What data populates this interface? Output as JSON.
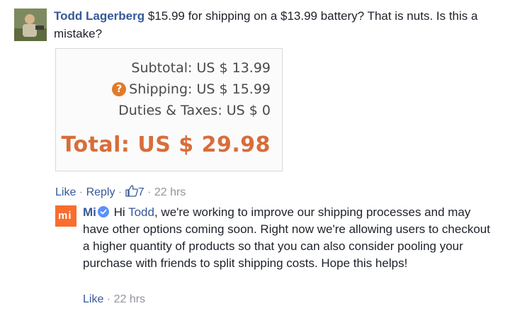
{
  "comment": {
    "author": "Todd Lagerberg",
    "text": " $15.99 for shipping on a $13.99 battery? That is nuts. Is this a mistake?",
    "attachment": {
      "subtotal": "Subtotal: US $ 13.99",
      "shipping": "Shipping: US $ 15.99",
      "shipping_icon": "?",
      "duties": "Duties & Taxes: US $ 0",
      "total": "Total: US $ 29.98"
    },
    "actions": {
      "like": "Like",
      "sep1": " · ",
      "reply": "Reply",
      "sep2": " · ",
      "like_count": "7",
      "sep3": " · ",
      "time": "22 hrs"
    }
  },
  "reply": {
    "logo_text": "mi",
    "author": "Mi",
    "text_before": " Hi ",
    "mention": "Todd",
    "text_after": ", we're working to improve our shipping processes and may have other options coming soon. Right now we're allowing users to checkout a higher quantity of products so that you can also consider pooling your purchase with friends to split shipping costs. Hope this helps!",
    "actions": {
      "like": "Like",
      "sep": " · ",
      "time": "22 hrs"
    }
  },
  "colors": {
    "link": "#365899",
    "meta": "#90949c",
    "total": "#d86d3a",
    "mi_brand": "#f96d2f",
    "verified": "#5890ff"
  },
  "icons": [
    "user-avatar",
    "question-icon",
    "thumbs-up-icon",
    "mi-logo",
    "verified-badge-icon"
  ]
}
